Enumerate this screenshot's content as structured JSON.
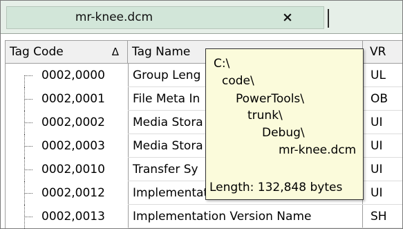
{
  "tab": {
    "title": "mr-knee.dcm",
    "close_icon": "×"
  },
  "table": {
    "columns": {
      "code": "Tag Code",
      "sort_indicator": "Δ",
      "name": "Tag Name",
      "vr": "VR"
    },
    "rows": [
      {
        "code": "0002,0000",
        "name": "Group Leng",
        "vr": "UL"
      },
      {
        "code": "0002,0001",
        "name": "File Meta In",
        "vr": "OB"
      },
      {
        "code": "0002,0002",
        "name": "Media Stora",
        "vr": "UI"
      },
      {
        "code": "0002,0003",
        "name": "Media Stora",
        "vr": "UI"
      },
      {
        "code": "0002,0010",
        "name": "Transfer Sy",
        "vr": "UI"
      },
      {
        "code": "0002,0012",
        "name": "Implementation Class UID",
        "vr": "UI"
      },
      {
        "code": "0002,0013",
        "name": "Implementation Version Name",
        "vr": "SH"
      }
    ]
  },
  "tooltip": {
    "path": [
      "C:\\",
      "code\\",
      "PowerTools\\",
      "trunk\\",
      "Debug\\",
      "mr-knee.dcm"
    ],
    "length": "Length: 132,848 bytes"
  }
}
